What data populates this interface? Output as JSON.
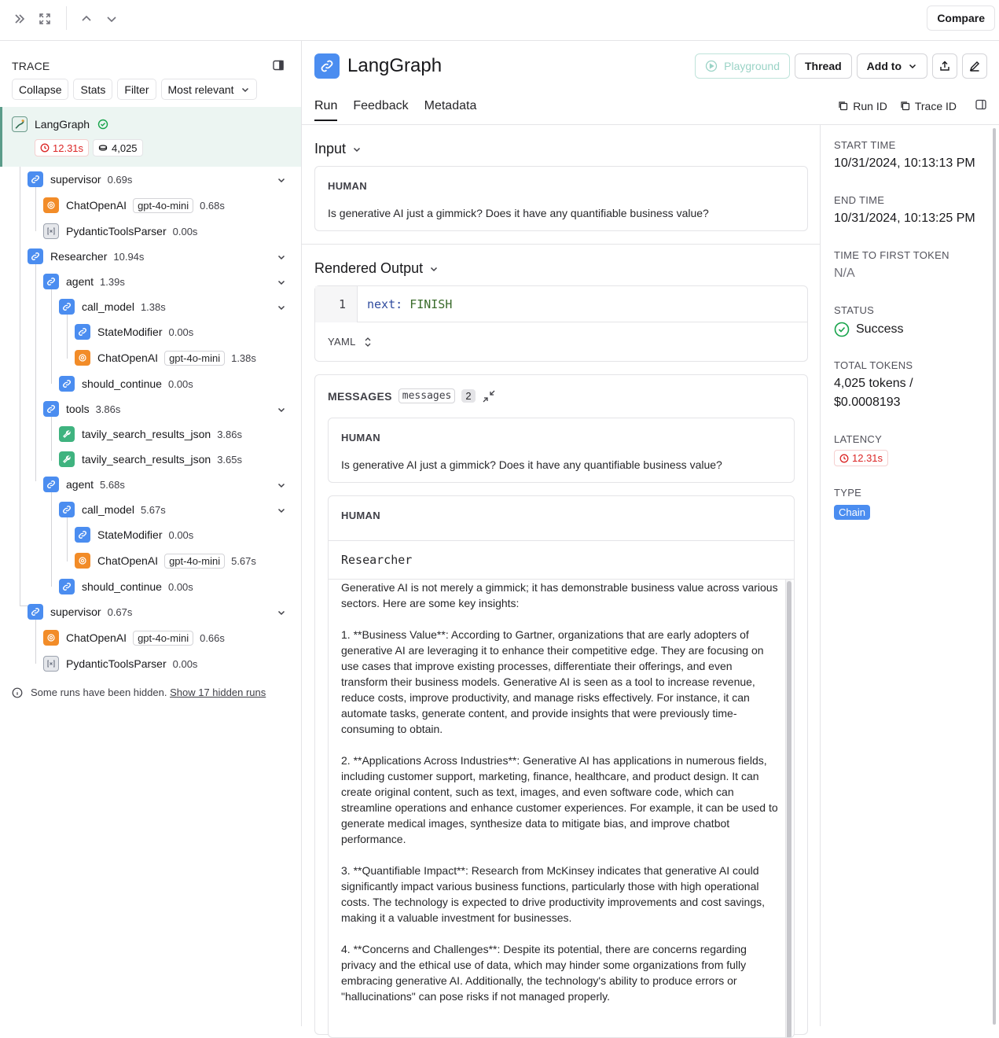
{
  "topbar": {
    "compare_label": "Compare"
  },
  "trace": {
    "title": "TRACE",
    "controls": [
      "Collapse",
      "Stats",
      "Filter",
      "Most relevant"
    ],
    "root": {
      "name": "LangGraph",
      "latency": "12.31s",
      "tokens": "4,025"
    },
    "nodes": [
      {
        "name": "supervisor",
        "time": "0.69s",
        "icon": "chain"
      },
      {
        "name": "ChatOpenAI",
        "tag": "gpt-4o-mini",
        "time": "0.68s",
        "icon": "openai"
      },
      {
        "name": "PydanticToolsParser",
        "time": "0.00s",
        "icon": "parser"
      },
      {
        "name": "Researcher",
        "time": "10.94s",
        "icon": "chain"
      },
      {
        "name": "agent",
        "time": "1.39s",
        "icon": "chain"
      },
      {
        "name": "call_model",
        "time": "1.38s",
        "icon": "chain"
      },
      {
        "name": "StateModifier",
        "time": "0.00s",
        "icon": "chain"
      },
      {
        "name": "ChatOpenAI",
        "tag": "gpt-4o-mini",
        "time": "1.38s",
        "icon": "openai"
      },
      {
        "name": "should_continue",
        "time": "0.00s",
        "icon": "chain"
      },
      {
        "name": "tools",
        "time": "3.86s",
        "icon": "chain"
      },
      {
        "name": "tavily_search_results_json",
        "time": "3.86s",
        "icon": "tool"
      },
      {
        "name": "tavily_search_results_json",
        "time": "3.65s",
        "icon": "tool"
      },
      {
        "name": "agent",
        "time": "5.68s",
        "icon": "chain"
      },
      {
        "name": "call_model",
        "time": "5.67s",
        "icon": "chain"
      },
      {
        "name": "StateModifier",
        "time": "0.00s",
        "icon": "chain"
      },
      {
        "name": "ChatOpenAI",
        "tag": "gpt-4o-mini",
        "time": "5.67s",
        "icon": "openai"
      },
      {
        "name": "should_continue",
        "time": "0.00s",
        "icon": "chain"
      },
      {
        "name": "supervisor",
        "time": "0.67s",
        "icon": "chain"
      },
      {
        "name": "ChatOpenAI",
        "tag": "gpt-4o-mini",
        "time": "0.66s",
        "icon": "openai"
      },
      {
        "name": "PydanticToolsParser",
        "time": "0.00s",
        "icon": "parser"
      }
    ],
    "hidden_note": "Some runs have been hidden.",
    "hidden_link": "Show 17 hidden runs"
  },
  "run": {
    "title": "LangGraph",
    "buttons": {
      "playground": "Playground",
      "thread": "Thread",
      "add_to": "Add to"
    },
    "tabs": [
      "Run",
      "Feedback",
      "Metadata"
    ],
    "run_id_label": "Run ID",
    "trace_id_label": "Trace ID",
    "input": {
      "title": "Input",
      "role": "HUMAN",
      "text": "Is generative AI just a gimmick? Does it have any quantifiable business value?"
    },
    "output": {
      "title": "Rendered Output",
      "line_number": "1",
      "key": "next:",
      "value": "FINISH",
      "format": "YAML"
    },
    "messages": {
      "title": "MESSAGES",
      "tag": "messages",
      "count": "2",
      "m1_role": "HUMAN",
      "m1_text": "Is generative AI just a gimmick? Does it have any quantifiable business value?",
      "m2_role": "HUMAN",
      "m2_name": "Researcher",
      "m2_text": "Generative AI is not merely a gimmick; it has demonstrable business value across various sectors. Here are some key insights:\n\n1. **Business Value**: According to Gartner, organizations that are early adopters of generative AI are leveraging it to enhance their competitive edge. They are focusing on use cases that improve existing processes, differentiate their offerings, and even transform their business models. Generative AI is seen as a tool to increase revenue, reduce costs, improve productivity, and manage risks effectively. For instance, it can automate tasks, generate content, and provide insights that were previously time-consuming to obtain.\n\n2. **Applications Across Industries**: Generative AI has applications in numerous fields, including customer support, marketing, finance, healthcare, and product design. It can create original content, such as text, images, and even software code, which can streamline operations and enhance customer experiences. For example, it can be used to generate medical images, synthesize data to mitigate bias, and improve chatbot performance.\n\n3. **Quantifiable Impact**: Research from McKinsey indicates that generative AI could significantly impact various business functions, particularly those with high operational costs. The technology is expected to drive productivity improvements and cost savings, making it a valuable investment for businesses.\n\n4. **Concerns and Challenges**: Despite its potential, there are concerns regarding privacy and the ethical use of data, which may hinder some organizations from fully embracing generative AI. Additionally, the technology's ability to produce errors or \"hallucinations\" can pose risks if not managed properly."
    }
  },
  "details": {
    "start_label": "START TIME",
    "start_value": "10/31/2024, 10:13:13 PM",
    "end_label": "END TIME",
    "end_value": "10/31/2024, 10:13:25 PM",
    "ttft_label": "TIME TO FIRST TOKEN",
    "ttft_value": "N/A",
    "status_label": "STATUS",
    "status_value": "Success",
    "tokens_label": "TOTAL TOKENS",
    "tokens_value": "4,025 tokens /",
    "cost_value": "$0.0008193",
    "latency_label": "LATENCY",
    "latency_value": "12.31s",
    "type_label": "TYPE",
    "type_value": "Chain"
  },
  "colors": {
    "chain": "#4b8df0",
    "openai": "#f28c28",
    "tool": "#3fb37f",
    "success": "#16a34a",
    "latency": "#dc2626"
  }
}
